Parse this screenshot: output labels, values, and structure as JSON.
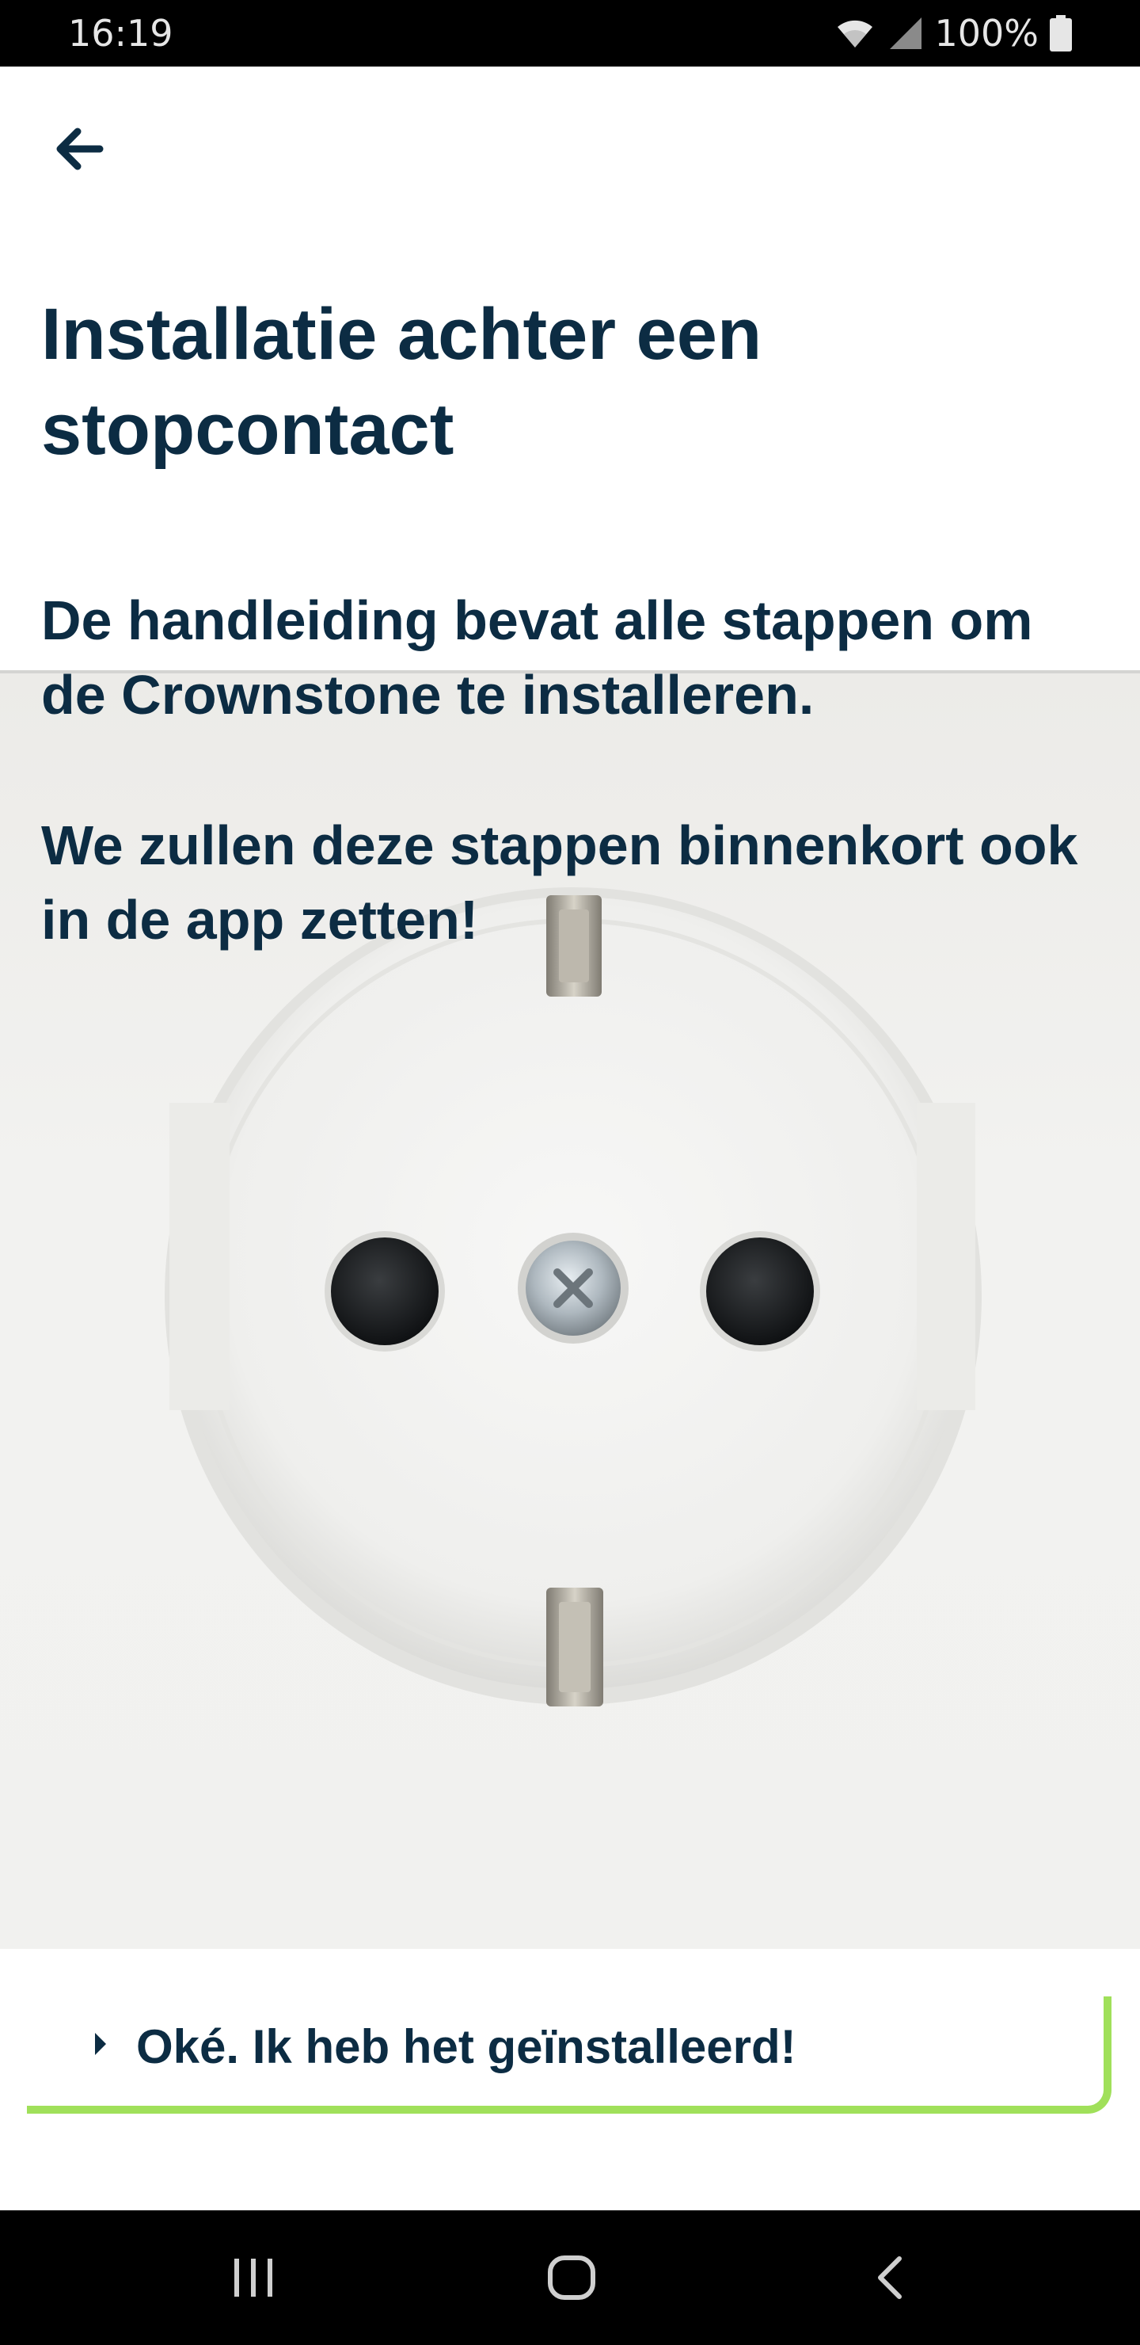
{
  "status_bar": {
    "time": "16:19",
    "battery_text": "100%",
    "icons": [
      "wifi-icon",
      "signal-icon",
      "battery-icon"
    ]
  },
  "header": {
    "back_icon": "arrow-left-icon",
    "title": "Installatie achter een stopcontact"
  },
  "content": {
    "paragraph_1": "De handleiding bevat alle stappen om de Crownstone te installeren.",
    "paragraph_2": "We zullen deze stappen binnenkort ook in de app zetten!",
    "image": "wall-socket-photo"
  },
  "action": {
    "label": "Oké. Ik heb het geïnstalleerd!",
    "icon": "chevron-right-icon",
    "accent_color": "#a0e05a"
  },
  "nav_bar": {
    "icons": [
      "recent-apps-icon",
      "home-icon",
      "back-icon"
    ]
  },
  "colors": {
    "text_primary": "#0c2c43",
    "accent": "#a0e05a"
  }
}
